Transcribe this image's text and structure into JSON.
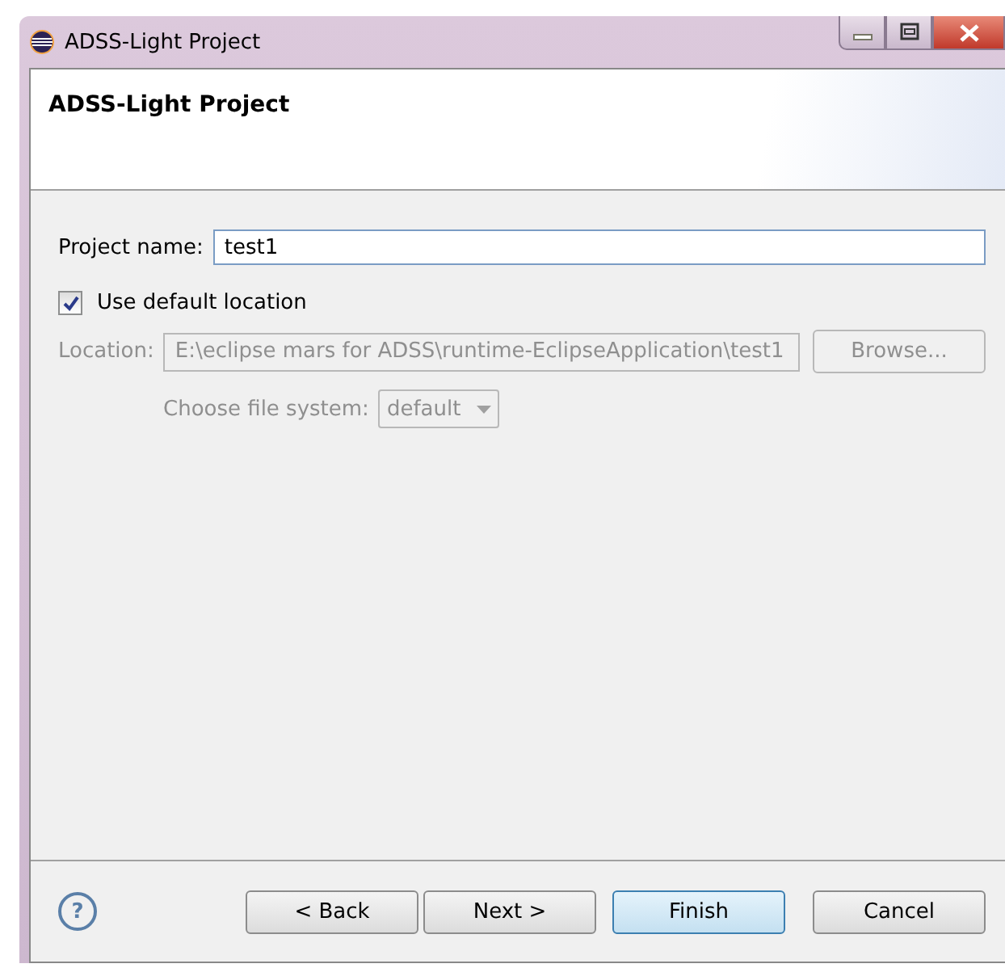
{
  "window": {
    "title": "ADSS-Light Project"
  },
  "header": {
    "title": "ADSS-Light Project"
  },
  "project_name": {
    "label": "Project name:",
    "value": "test1"
  },
  "use_default_location": {
    "label": "Use default location",
    "checked": true
  },
  "location": {
    "label": "Location:",
    "value": "E:\\eclipse mars for ADSS\\runtime-EclipseApplication\\test1",
    "disabled": true
  },
  "browse_button": {
    "label": "Browse...",
    "disabled": true
  },
  "file_system": {
    "label": "Choose file system:",
    "value": "default",
    "disabled": true
  },
  "help_button": {
    "label": "?"
  },
  "buttons": [
    {
      "label": "< Back",
      "default": false
    },
    {
      "label": "Next >",
      "default": false
    },
    {
      "label": "Finish",
      "default": true
    },
    {
      "label": "Cancel",
      "default": false
    }
  ]
}
